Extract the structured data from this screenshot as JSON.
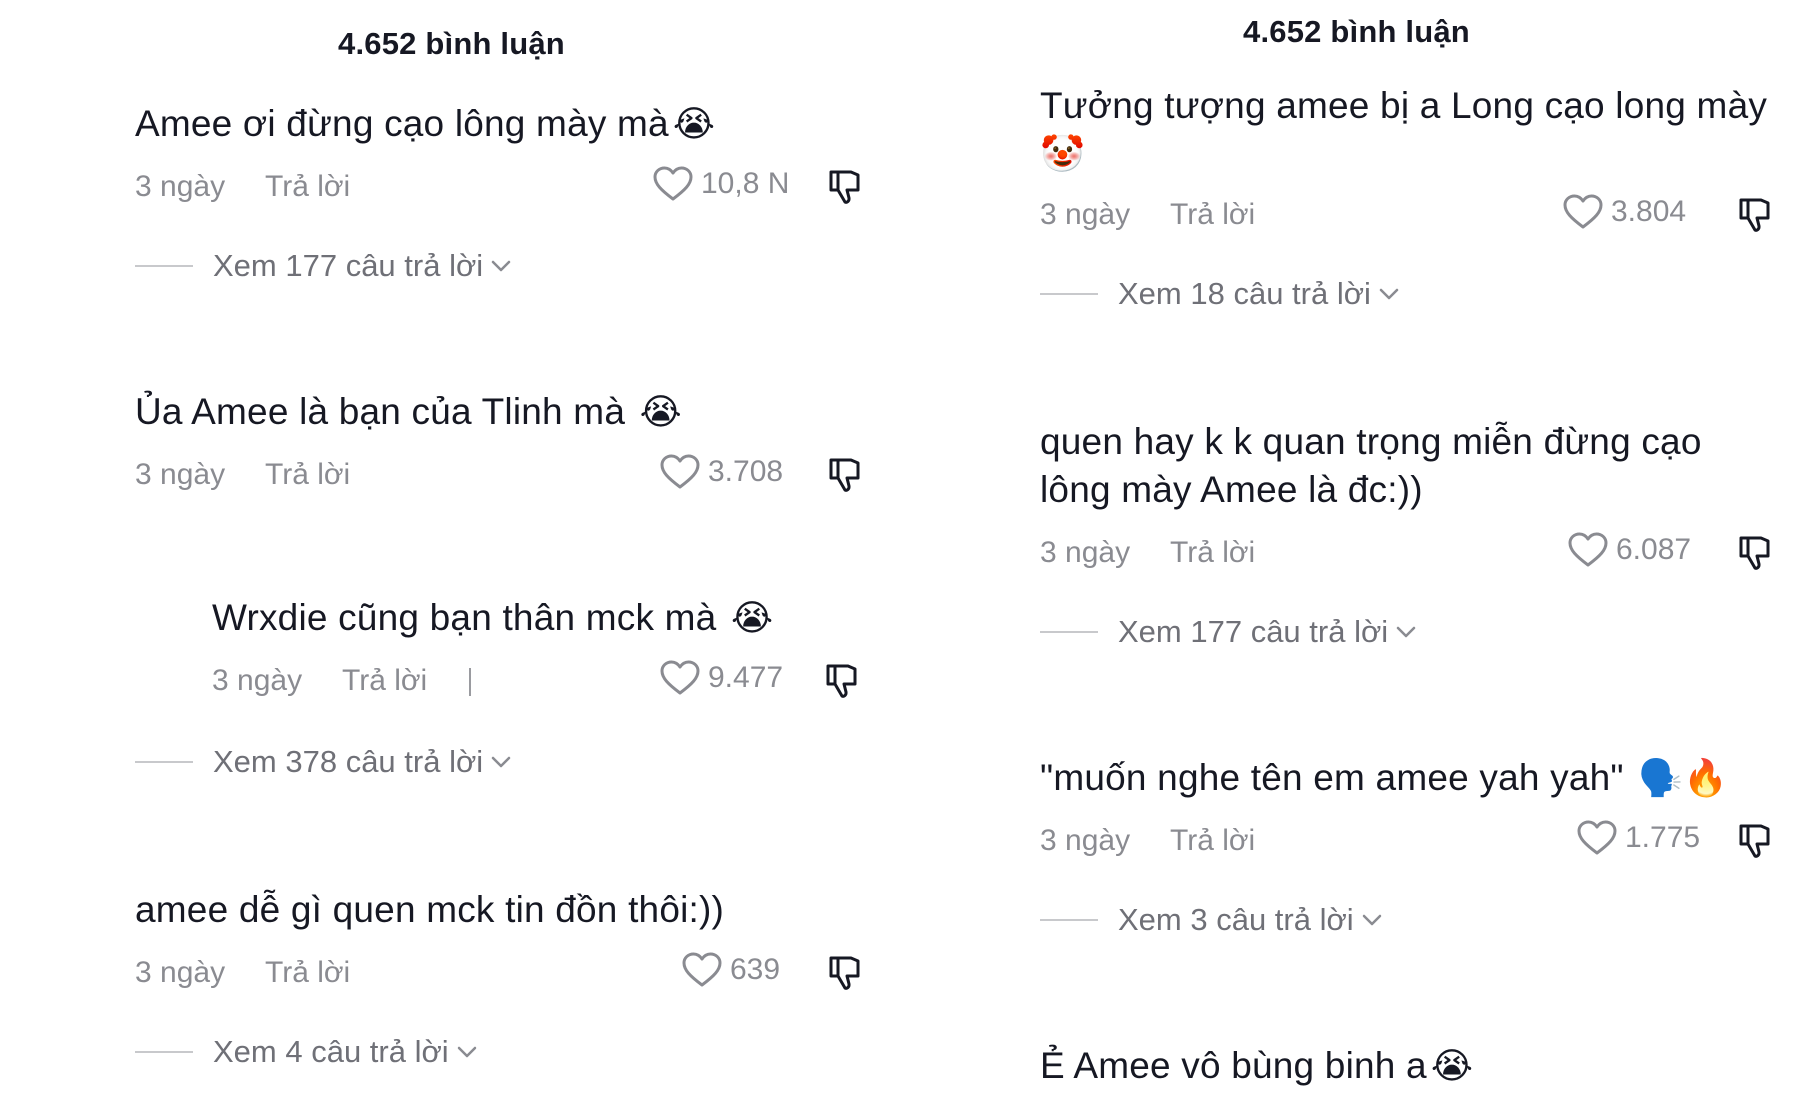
{
  "left": {
    "count": "4.652 bình luận",
    "comments": [
      {
        "text": "Amee ơi đừng cạo lông mày mà",
        "emoji": "😭",
        "time": "3 ngày",
        "reply": "Trả lời",
        "likes": "10,8 N",
        "view_replies": "Xem 177 câu trả lời"
      },
      {
        "text": "Ủa Amee là bạn của Tlinh mà",
        "emoji": "😭",
        "time": "3 ngày",
        "reply": "Trả lời",
        "likes": "3.708"
      },
      {
        "text": "Wrxdie cũng bạn thân mck mà",
        "emoji": "😭",
        "time": "3 ngày",
        "reply": "Trả lời",
        "likes": "9.477",
        "view_replies": "Xem 378 câu trả lời"
      },
      {
        "text": "amee dễ gì quen mck tin đồn thôi:))",
        "time": "3 ngày",
        "reply": "Trả lời",
        "likes": "639",
        "view_replies": "Xem 4 câu trả lời"
      }
    ]
  },
  "right": {
    "count": "4.652 bình luận",
    "comments": [
      {
        "text_line1": "Tưởng tượng amee bị a Long cạo long mày",
        "emoji": "🤡",
        "time": "3 ngày",
        "reply": "Trả lời",
        "likes": "3.804",
        "view_replies": "Xem 18 câu trả lời"
      },
      {
        "text_line1": "quen hay k k quan trọng miễn đừng cạo",
        "text_line2": "lông mày Amee là đc:))",
        "time": "3 ngày",
        "reply": "Trả lời",
        "likes": "6.087",
        "view_replies": "Xem 177 câu trả lời"
      },
      {
        "text": "\"muốn nghe tên em amee yah yah\"",
        "emoji": "🗣️🔥",
        "time": "3 ngày",
        "reply": "Trả lời",
        "likes": "1.775",
        "view_replies": "Xem 3 câu trả lời"
      },
      {
        "text": "Ẻ Amee vô bùng binh a",
        "emoji": "😭"
      }
    ]
  },
  "icons": {
    "like": "heart-outline-icon",
    "dislike": "thumbs-down-outline-icon",
    "expand": "chevron-down-icon"
  },
  "colors": {
    "text": "#161823",
    "meta": "#8a8b91",
    "link": "#6f7077"
  }
}
